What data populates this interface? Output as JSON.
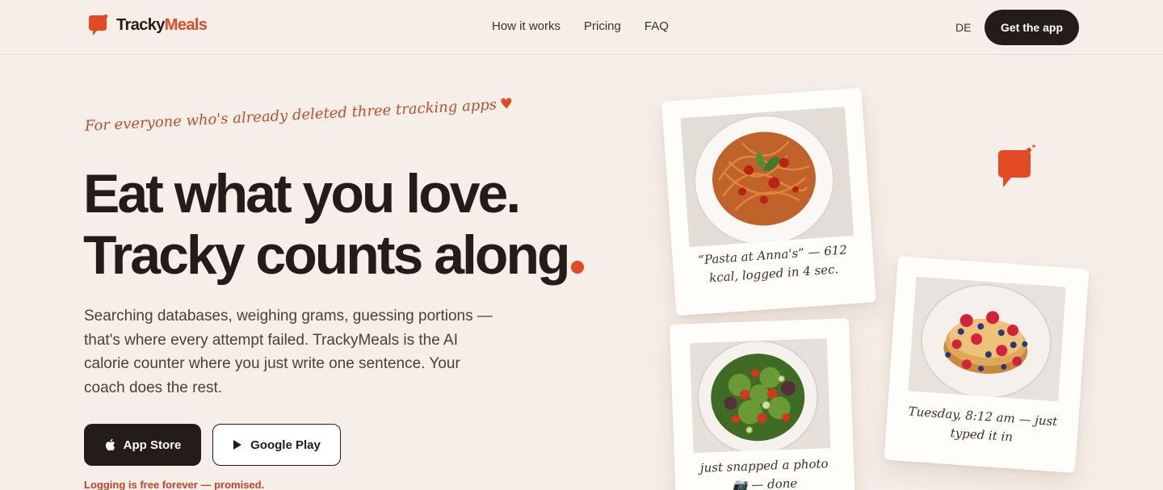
{
  "header": {
    "brand": {
      "part1": "Tracky",
      "part2": "Meals"
    },
    "nav": [
      {
        "label": "How it works"
      },
      {
        "label": "Pricing"
      },
      {
        "label": "FAQ"
      }
    ],
    "language": "DE",
    "cta": "Get the app"
  },
  "hero": {
    "tagline": "For everyone who's already deleted three tracking apps",
    "headline_line1": "Eat what you love.",
    "headline_line2": "Tracky counts along",
    "description": "Searching databases, weighing grams, guessing portions — that's where every attempt failed. TrackyMeals is the AI calorie counter where you just write one sentence. Your coach does the rest.",
    "app_store": "App Store",
    "google_play": "Google Play",
    "note": "Logging is free forever — promised."
  },
  "polaroids": [
    {
      "caption_line1": "“Pasta at Anna's” — 612",
      "caption_line2": "kcal, logged in 4 sec."
    },
    {
      "caption_line1": "just snapped a photo",
      "caption_line2": "📷 — done"
    },
    {
      "caption_line1": "Tuesday, 8:12 am — just",
      "caption_line2": "typed it in"
    }
  ],
  "colors": {
    "background": "#f6eee8",
    "accent": "#e14a22",
    "text": "#231c19"
  }
}
